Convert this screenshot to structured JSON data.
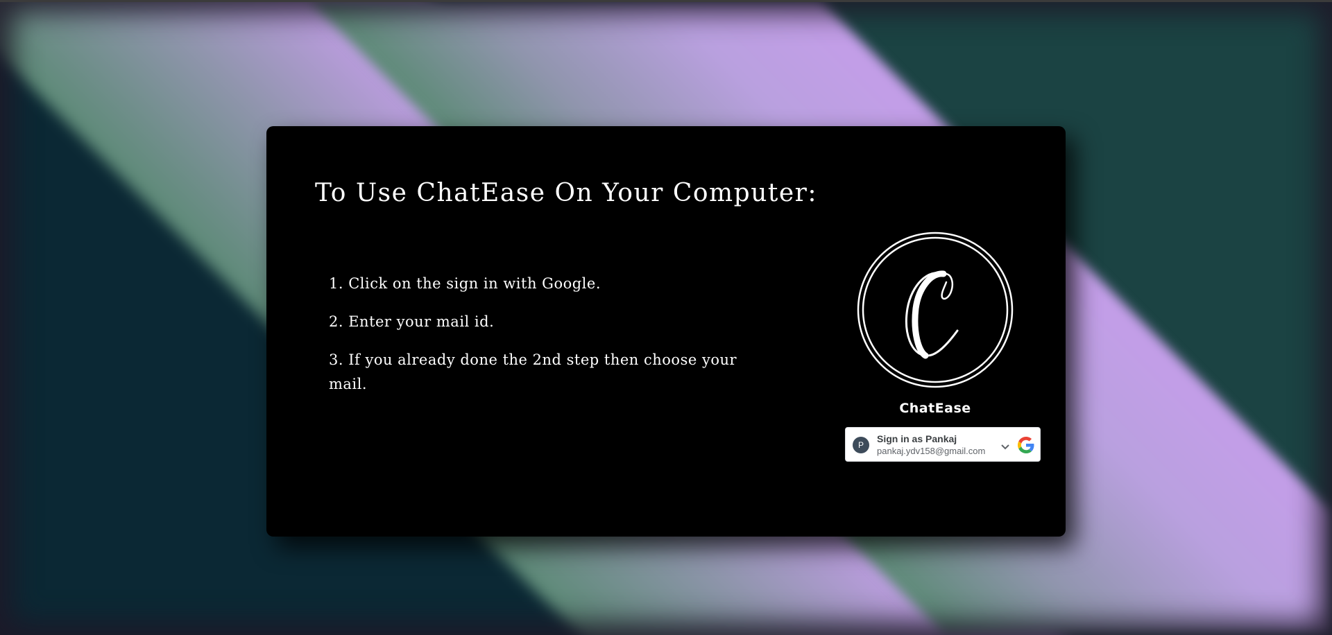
{
  "page": {
    "heading": "To Use ChatEase On Your Computer:",
    "steps": [
      "1. Click on the sign in with Google.",
      "2. Enter your mail id.",
      "3. If you already done the 2nd step then choose your mail."
    ]
  },
  "logo": {
    "letter": "C",
    "icon": "chatease-logo-icon",
    "brand_name": "ChatEase"
  },
  "google_signin": {
    "avatar_initial": "P",
    "title": "Sign in as Pankaj",
    "email": "pankaj.ydv158@gmail.com",
    "chevron_icon": "chevron-down-icon",
    "google_icon": "google-g-icon"
  },
  "colors": {
    "card_background": "#000000",
    "text": "#ffffff",
    "bg_teal_dark": "#0b2834",
    "bg_green": "#5c8a76",
    "bg_lavender": "#c49ee9",
    "bg_teal": "#1b4343"
  }
}
